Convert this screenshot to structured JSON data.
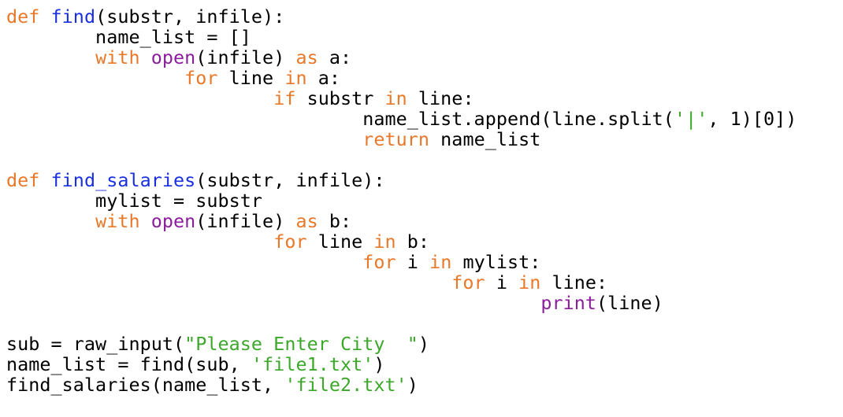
{
  "editor": {
    "language": "python",
    "colors": {
      "keyword": "#e8782a",
      "function_name": "#1a2fe0",
      "builtin": "#8b1e9b",
      "string": "#3ba82a",
      "text": "#000000",
      "background": "#ffffff"
    },
    "lines": [
      [
        {
          "t": "kw",
          "v": "def"
        },
        {
          "t": "plain",
          "v": " "
        },
        {
          "t": "def",
          "v": "find"
        },
        {
          "t": "plain",
          "v": "(substr, infile):"
        }
      ],
      [
        {
          "t": "plain",
          "v": "        name_list = []"
        }
      ],
      [
        {
          "t": "plain",
          "v": "        "
        },
        {
          "t": "kw",
          "v": "with"
        },
        {
          "t": "plain",
          "v": " "
        },
        {
          "t": "bi",
          "v": "open"
        },
        {
          "t": "plain",
          "v": "(infile) "
        },
        {
          "t": "kw",
          "v": "as"
        },
        {
          "t": "plain",
          "v": " a:"
        }
      ],
      [
        {
          "t": "plain",
          "v": "                "
        },
        {
          "t": "kw",
          "v": "for"
        },
        {
          "t": "plain",
          "v": " line "
        },
        {
          "t": "kw",
          "v": "in"
        },
        {
          "t": "plain",
          "v": " a:"
        }
      ],
      [
        {
          "t": "plain",
          "v": "                        "
        },
        {
          "t": "kw",
          "v": "if"
        },
        {
          "t": "plain",
          "v": " substr "
        },
        {
          "t": "kw",
          "v": "in"
        },
        {
          "t": "plain",
          "v": " line:"
        }
      ],
      [
        {
          "t": "plain",
          "v": "                                name_list.append(line.split("
        },
        {
          "t": "str",
          "v": "'|'"
        },
        {
          "t": "plain",
          "v": ", 1)[0])"
        }
      ],
      [
        {
          "t": "plain",
          "v": "                                "
        },
        {
          "t": "kw",
          "v": "return"
        },
        {
          "t": "plain",
          "v": " name_list"
        }
      ],
      [
        {
          "t": "plain",
          "v": ""
        }
      ],
      [
        {
          "t": "kw",
          "v": "def"
        },
        {
          "t": "plain",
          "v": " "
        },
        {
          "t": "def",
          "v": "find_salaries"
        },
        {
          "t": "plain",
          "v": "(substr, infile):"
        }
      ],
      [
        {
          "t": "plain",
          "v": "        mylist = substr"
        }
      ],
      [
        {
          "t": "plain",
          "v": "        "
        },
        {
          "t": "kw",
          "v": "with"
        },
        {
          "t": "plain",
          "v": " "
        },
        {
          "t": "bi",
          "v": "open"
        },
        {
          "t": "plain",
          "v": "(infile) "
        },
        {
          "t": "kw",
          "v": "as"
        },
        {
          "t": "plain",
          "v": " b:"
        }
      ],
      [
        {
          "t": "plain",
          "v": "                        "
        },
        {
          "t": "kw",
          "v": "for"
        },
        {
          "t": "plain",
          "v": " line "
        },
        {
          "t": "kw",
          "v": "in"
        },
        {
          "t": "plain",
          "v": " b:"
        }
      ],
      [
        {
          "t": "plain",
          "v": "                                "
        },
        {
          "t": "kw",
          "v": "for"
        },
        {
          "t": "plain",
          "v": " i "
        },
        {
          "t": "kw",
          "v": "in"
        },
        {
          "t": "plain",
          "v": " mylist:"
        }
      ],
      [
        {
          "t": "plain",
          "v": "                                        "
        },
        {
          "t": "kw",
          "v": "for"
        },
        {
          "t": "plain",
          "v": " i "
        },
        {
          "t": "kw",
          "v": "in"
        },
        {
          "t": "plain",
          "v": " line:"
        }
      ],
      [
        {
          "t": "plain",
          "v": "                                                "
        },
        {
          "t": "bi",
          "v": "print"
        },
        {
          "t": "plain",
          "v": "(line)"
        }
      ],
      [
        {
          "t": "plain",
          "v": ""
        }
      ],
      [
        {
          "t": "plain",
          "v": "sub = raw_input("
        },
        {
          "t": "str",
          "v": "\"Please Enter City  \""
        },
        {
          "t": "plain",
          "v": ")"
        }
      ],
      [
        {
          "t": "plain",
          "v": "name_list = find(sub, "
        },
        {
          "t": "str",
          "v": "'file1.txt'"
        },
        {
          "t": "plain",
          "v": ")"
        }
      ],
      [
        {
          "t": "plain",
          "v": "find_salaries(name_list, "
        },
        {
          "t": "str",
          "v": "'file2.txt'"
        },
        {
          "t": "plain",
          "v": ")"
        }
      ]
    ]
  }
}
